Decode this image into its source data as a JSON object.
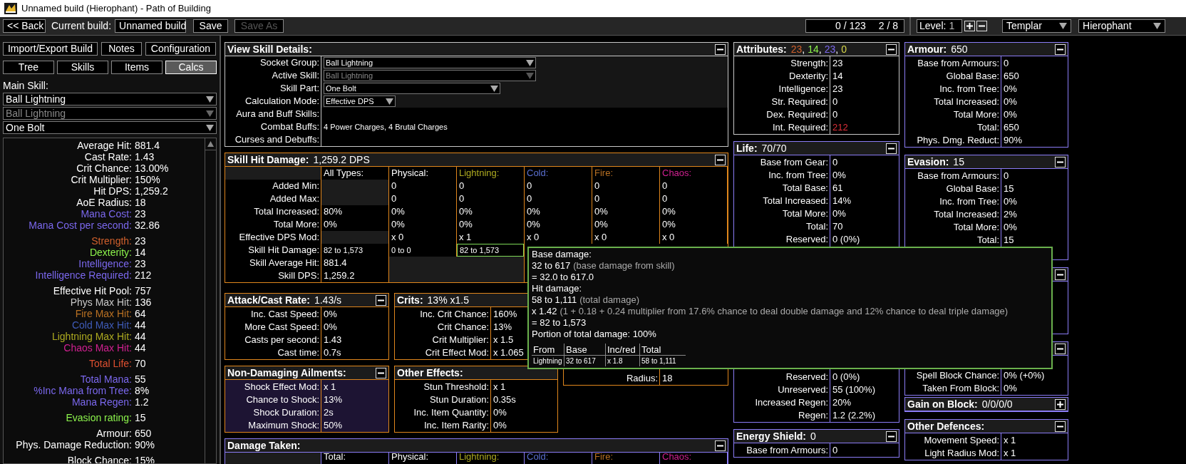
{
  "window": {
    "title": "Unnamed build (Hierophant) - Path of Building"
  },
  "toolbar": {
    "back": "<< Back",
    "build_label": "Current build:",
    "build_name": "Unnamed build",
    "buttons": [
      {
        "label": "Save",
        "disabled": false
      },
      {
        "label": "Save As",
        "disabled": true
      }
    ],
    "counters": [
      "0 / 123",
      "2 / 8"
    ],
    "level": {
      "label": "Level:",
      "value": "1"
    },
    "class_select": "Templar",
    "ascendancy_select": "Hierophant"
  },
  "sidebar": {
    "top_buttons": [
      "Import/Export Build",
      "Notes",
      "Configuration"
    ],
    "tabs": [
      {
        "label": "Tree",
        "selected": false
      },
      {
        "label": "Skills",
        "selected": false
      },
      {
        "label": "Items",
        "selected": false
      },
      {
        "label": "Calcs",
        "selected": true
      }
    ],
    "main_skill_label": "Main Skill:",
    "skill_selects": [
      {
        "value": "Ball Lightning",
        "disabled": false
      },
      {
        "value": "Ball Lightning",
        "disabled": true
      },
      {
        "value": "One Bolt",
        "disabled": false
      }
    ],
    "stat_groups": [
      [
        {
          "label": "Average Hit:",
          "value": "881.4",
          "color": "#ffffff"
        },
        {
          "label": "Cast Rate:",
          "value": "1.43",
          "color": "#ffffff"
        },
        {
          "label": "Crit Chance:",
          "value": "13.00%",
          "color": "#ffffff"
        },
        {
          "label": "Crit Multiplier:",
          "value": "150%",
          "color": "#ffffff"
        },
        {
          "label": "Hit DPS:",
          "value": "1,259.2",
          "color": "#ffffff"
        },
        {
          "label": "AoE Radius:",
          "value": "18",
          "color": "#ffffff"
        },
        {
          "label": "Mana Cost:",
          "value": "23",
          "color": "#7b68ee"
        },
        {
          "label": "Mana Cost per second:",
          "value": "32.86",
          "color": "#7b68ee"
        }
      ],
      [
        {
          "label": "Strength:",
          "value": "23",
          "color": "#d0602c"
        },
        {
          "label": "Dexterity:",
          "value": "14",
          "color": "#8cf34c"
        },
        {
          "label": "Intelligence:",
          "value": "23",
          "color": "#7b68ee"
        },
        {
          "label": "Intelligence Required:",
          "value": "212",
          "color": "#7b68ee"
        }
      ],
      [
        {
          "label": "Effective Hit Pool:",
          "value": "757",
          "color": "#ffffff"
        },
        {
          "label": "Phys Max Hit:",
          "value": "136",
          "color": "#c8c8c8"
        },
        {
          "label": "Fire Max Hit:",
          "value": "64",
          "color": "#b97123"
        },
        {
          "label": "Cold Max Hit:",
          "value": "44",
          "color": "#3f5bb8"
        },
        {
          "label": "Lightning Max Hit:",
          "value": "44",
          "color": "#adaa20"
        },
        {
          "label": "Chaos Max Hit:",
          "value": "44",
          "color": "#d02090"
        }
      ],
      [
        {
          "label": "Total Life:",
          "value": "70",
          "color": "#e05030"
        }
      ],
      [
        {
          "label": "Total Mana:",
          "value": "55",
          "color": "#7b68ee"
        },
        {
          "label": "%Inc Mana from Tree:",
          "value": "8%",
          "color": "#7b68ee"
        },
        {
          "label": "Mana Regen:",
          "value": "1.2",
          "color": "#7b68ee"
        }
      ],
      [
        {
          "label": "Evasion rating:",
          "value": "15",
          "color": "#8cf34c"
        }
      ],
      [
        {
          "label": "Armour:",
          "value": "650",
          "color": "#ffffff"
        },
        {
          "label": "Phys. Damage Reduction:",
          "value": "90%",
          "color": "#ffffff"
        }
      ],
      [
        {
          "label": "Block Chance:",
          "value": "15%",
          "color": "#ffffff"
        }
      ]
    ]
  },
  "view_skill_details": {
    "title": "View Skill Details:",
    "color": "#c8c8c8",
    "collapsed": false,
    "rows": [
      {
        "label": "Socket Group:",
        "kind": "dropdown",
        "value": "Ball Lightning",
        "disabled": false
      },
      {
        "label": "Active Skill:",
        "kind": "dropdown",
        "value": "Ball Lightning",
        "disabled": true
      },
      {
        "label": "Skill Part:",
        "kind": "dropdown",
        "value": "One Bolt",
        "disabled": false
      },
      {
        "label": "Calculation Mode:",
        "kind": "dropdown",
        "value": "Effective DPS",
        "disabled": false
      },
      {
        "label": "Aura and Buff Skills:",
        "kind": "text"
      },
      {
        "label": "Combat Buffs:",
        "kind": "text",
        "value": "4 Power Charges, 4 Brutal Charges"
      },
      {
        "label": "Curses and Debuffs:",
        "kind": "text"
      }
    ]
  },
  "skill_hit_damage": {
    "title": "Skill Hit Damage:",
    "value": "1,259.2 DPS",
    "color": "#e0861c",
    "collapsed": false,
    "columns": [
      {
        "label": "All Types:",
        "color": "#ffffff"
      },
      {
        "label": "Physical:",
        "color": "#ffffff"
      },
      {
        "label": "Lightning:",
        "color": "#adaa20"
      },
      {
        "label": "Cold:",
        "color": "#5a6fd0"
      },
      {
        "label": "Fire:",
        "color": "#b97123"
      },
      {
        "label": "Chaos:",
        "color": "#d02090"
      }
    ],
    "rows": [
      {
        "label": "Added Min:",
        "cells": [
          {
            "kind": "blank"
          },
          {
            "kind": "text",
            "text": "0"
          },
          {
            "kind": "text",
            "text": "0"
          },
          {
            "kind": "text",
            "text": "0"
          },
          {
            "kind": "text",
            "text": "0"
          },
          {
            "kind": "text",
            "text": "0"
          }
        ]
      },
      {
        "label": "Added Max:",
        "cells": [
          {
            "kind": "blank"
          },
          {
            "kind": "text",
            "text": "0"
          },
          {
            "kind": "text",
            "text": "0"
          },
          {
            "kind": "text",
            "text": "0"
          },
          {
            "kind": "text",
            "text": "0"
          },
          {
            "kind": "text",
            "text": "0"
          }
        ]
      },
      {
        "label": "Total Increased:",
        "cells": [
          {
            "kind": "text",
            "text": "80%"
          },
          {
            "kind": "text",
            "text": "0%"
          },
          {
            "kind": "text",
            "text": "0%"
          },
          {
            "kind": "text",
            "text": "0%"
          },
          {
            "kind": "text",
            "text": "0%"
          },
          {
            "kind": "text",
            "text": "0%"
          }
        ]
      },
      {
        "label": "Total More:",
        "cells": [
          {
            "kind": "text",
            "text": "0%"
          },
          {
            "kind": "text",
            "text": "0%"
          },
          {
            "kind": "text",
            "text": "0%"
          },
          {
            "kind": "text",
            "text": "0%"
          },
          {
            "kind": "text",
            "text": "0%"
          },
          {
            "kind": "text",
            "text": "0%"
          }
        ]
      },
      {
        "label": "Effective DPS Mod:",
        "cells": [
          {
            "kind": "blank"
          },
          {
            "kind": "text",
            "text": "x 0"
          },
          {
            "kind": "text",
            "text": "x 1"
          },
          {
            "kind": "text",
            "text": "x 0"
          },
          {
            "kind": "text",
            "text": "x 0"
          },
          {
            "kind": "text",
            "text": "x 0"
          }
        ]
      },
      {
        "label": "Skill Hit Damage:",
        "cells": [
          {
            "kind": "small",
            "text": "82 to 1,573",
            "highlighted": false
          },
          {
            "kind": "small",
            "text": "0 to 0",
            "highlighted": false
          },
          {
            "kind": "small",
            "text": "82 to 1,573",
            "highlighted": true
          }
        ]
      },
      {
        "label": "Skill Average Hit:",
        "cells": [
          {
            "kind": "text",
            "text": "881.4"
          },
          {
            "kind": "blank"
          },
          {
            "kind": "blank"
          }
        ]
      },
      {
        "label": "Skill DPS:",
        "cells": [
          {
            "kind": "text",
            "text": "1,259.2"
          },
          {
            "kind": "blank"
          },
          {
            "kind": "blank"
          }
        ]
      }
    ]
  },
  "small_panels": [
    [
      {
        "title": "Attack/Cast Rate:",
        "value": "1.43/s",
        "color": "#e0861c",
        "collapsed": false,
        "rows": [
          {
            "label": "Inc. Cast Speed:",
            "value": "0%"
          },
          {
            "label": "More Cast Speed:",
            "value": "0%"
          },
          {
            "label": "Casts per second:",
            "value": "1.43"
          },
          {
            "label": "Cast time:",
            "value": "0.7s"
          }
        ]
      },
      {
        "title": "Non-Damaging Ailments:",
        "color": "#e0861c",
        "collapsed": false,
        "rows": [
          {
            "label": "Shock Effect Mod:",
            "value": "x 1"
          },
          {
            "label": "Chance to Shock:",
            "value": "13%"
          },
          {
            "label": "Shock Duration:",
            "value": "2s"
          },
          {
            "label": "Maximum Shock:",
            "value": "50%"
          }
        ]
      }
    ],
    [
      {
        "title": "Crits:",
        "value": "13% x1.5",
        "color": "#e0861c",
        "rows": [
          {
            "label": "Inc. Crit Chance:",
            "value": "160%"
          },
          {
            "label": "Crit Chance:",
            "value": "13%"
          },
          {
            "label": "Crit Multiplier:",
            "value": "x 1.5"
          },
          {
            "label": "Crit Effect Mod:",
            "value": "x 1.065"
          }
        ]
      },
      {
        "title": "Other Effects:",
        "color": "#e0861c",
        "rows": [
          {
            "label": "Stun Threshold:",
            "value": "x 1"
          },
          {
            "label": "Stun Duration:",
            "value": "0.35s"
          },
          {
            "label": "Inc. Item Quantity:",
            "value": "0%"
          },
          {
            "label": "Inc. Item Rarity:",
            "value": "0%"
          }
        ]
      }
    ],
    [
      {
        "color": "#e0861c",
        "rows": [
          {
            "label": "Radius:",
            "value": "18"
          }
        ]
      }
    ]
  ],
  "damage_taken": {
    "title": "Damage Taken:",
    "color": "#8b7cf6",
    "collapsed": false,
    "columns": [
      {
        "label": "Total:",
        "color": "#ffffff"
      },
      {
        "label": "Physical:",
        "color": "#ffffff"
      },
      {
        "label": "Lightning:",
        "color": "#adaa20"
      },
      {
        "label": "Cold:",
        "color": "#5a6fd0"
      },
      {
        "label": "Fire:",
        "color": "#b97123"
      },
      {
        "label": "Chaos:",
        "color": "#d02090"
      }
    ]
  },
  "defence_columns": [
    [
      {
        "title": "Attributes:",
        "title_parts": [
          {
            "text": "23",
            "color": "#d0602c"
          },
          {
            "text": ","
          },
          {
            "text": "14",
            "color": "#8cf34c"
          },
          {
            "text": ","
          },
          {
            "text": "23",
            "color": "#7b68ee"
          },
          {
            "text": ","
          },
          {
            "text": "0",
            "color": "#d8d84a"
          }
        ],
        "color": "#c8c8c8",
        "collapsed": false,
        "rows": [
          {
            "label": "Strength:",
            "value": "23"
          },
          {
            "label": "Dexterity:",
            "value": "14"
          },
          {
            "label": "Intelligence:",
            "value": "23"
          },
          {
            "label": "Str. Required:",
            "value": "0"
          },
          {
            "label": "Dex. Required:",
            "value": "0"
          },
          {
            "label": "Int. Required:",
            "value": "212",
            "color": "#e0303a"
          }
        ]
      },
      {
        "title": "Life:",
        "value": "70/70",
        "color": "#8b7cf6",
        "collapsed": false,
        "rows": [
          {
            "label": "Base from Gear:",
            "value": "0"
          },
          {
            "label": "Inc. from Tree:",
            "value": "0%"
          },
          {
            "label": "Total Base:",
            "value": "61"
          },
          {
            "label": "Total Increased:",
            "value": "14%"
          },
          {
            "label": "Total More:",
            "value": "0%"
          },
          {
            "label": "Total:",
            "value": "70"
          },
          {
            "label": "Reserved:",
            "value": "0 (0%)"
          }
        ]
      },
      {
        "color": "#8b7cf6",
        "rows": [
          {
            "label": "Reserved:",
            "value": "0 (0%)"
          },
          {
            "label": "Unreserved:",
            "value": "55 (100%)"
          },
          {
            "label": "Increased Regen:",
            "value": "20%"
          },
          {
            "label": "Regen:",
            "value": "1.2 (2.2%)"
          }
        ]
      },
      {
        "title": "Energy Shield:",
        "value": "0",
        "color": "#8b7cf6",
        "collapsed": false,
        "rows": [
          {
            "label": "Base from Armours:",
            "value": "0"
          }
        ]
      }
    ],
    [
      {
        "title": "Armour:",
        "value": "650",
        "color": "#8b7cf6",
        "collapsed": false,
        "rows": [
          {
            "label": "Base from Armours:",
            "value": "0"
          },
          {
            "label": "Global Base:",
            "value": "650"
          },
          {
            "label": "Inc. from Tree:",
            "value": "0%"
          },
          {
            "label": "Total Increased:",
            "value": "0%"
          },
          {
            "label": "Total More:",
            "value": "0%"
          },
          {
            "label": "Total:",
            "value": "650"
          },
          {
            "label": "Phys. Dmg. Reduct:",
            "value": "90%"
          }
        ]
      },
      {
        "title": "Evasion:",
        "value": "15",
        "color": "#8b7cf6",
        "collapsed": false,
        "rows": [
          {
            "label": "Base from Armours:",
            "value": "0"
          },
          {
            "label": "Global Base:",
            "value": "15"
          },
          {
            "label": "Inc. from Tree:",
            "value": "0%"
          },
          {
            "label": "Total Increased:",
            "value": "2%"
          },
          {
            "label": "Total More:",
            "value": "0%"
          },
          {
            "label": "Total:",
            "value": "15"
          }
        ]
      },
      {
        "color": "#8b7cf6",
        "collapsed": false
      },
      {
        "color": "#8b7cf6",
        "collapsed": false,
        "rows": [
          {
            "label": "Spell Block Chance:",
            "value": "0% (+0%)"
          },
          {
            "label": "Taken From Block:",
            "value": "0%"
          }
        ]
      },
      {
        "title": "Gain on Block:",
        "value": "0/0/0/0",
        "color": "#8b7cf6",
        "collapsed": true
      },
      {
        "title": "Other Defences:",
        "color": "#8b7cf6",
        "collapsed": false,
        "rows": [
          {
            "label": "Movement Speed:",
            "value": "x 1"
          },
          {
            "label": "Light Radius Mod:",
            "value": "x 1"
          }
        ]
      }
    ]
  ],
  "tooltip": {
    "lines": [
      {
        "text": "Base damage:"
      },
      {
        "text": "32 to 617",
        "note": "(base damage from skill)"
      },
      {
        "text": "= 32.0 to 617.0"
      },
      {
        "text": "Hit damage:"
      },
      {
        "text": "58 to 1,111",
        "note": "(total damage)"
      },
      {
        "text": "x 1.42",
        "note": "(1 + 0.18 + 0.24 multiplier from 17.6% chance to deal double damage and 12% chance to deal triple damage)"
      },
      {
        "text": "= 82 to 1,573"
      },
      {
        "text": "Portion of total damage: 100%"
      }
    ],
    "table": {
      "columns": [
        "From",
        "Base",
        "Inc/red",
        "Total"
      ],
      "rows": [
        [
          "Lightning",
          "32 to 617",
          "x 1.8",
          "58 to 1,111"
        ]
      ]
    }
  }
}
